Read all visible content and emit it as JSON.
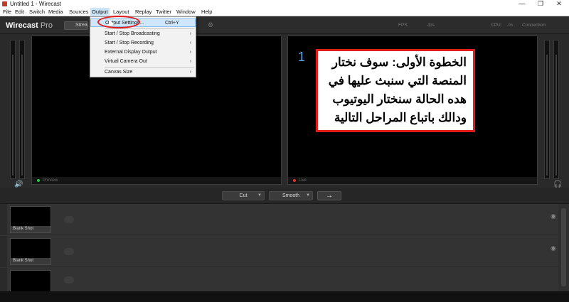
{
  "window": {
    "title": "Untitled 1 - Wirecast",
    "minimize": "—",
    "maximize": "❐",
    "close": "✕"
  },
  "menubar": [
    "File",
    "Edit",
    "Switch",
    "Media",
    "Sources",
    "Output",
    "Layout",
    "Replay",
    "Twitter",
    "Window",
    "Help"
  ],
  "toolbar": {
    "logo": "Wirecast",
    "logo_suffix": "Pro",
    "stream_label": "Stream",
    "fps_label": "FPS:",
    "fps_value": "-fps",
    "cpu_label": "CPU:",
    "cpu_value": "-%",
    "connection_label": "Connection:"
  },
  "output_menu": {
    "items": [
      {
        "label": "Output Settings...",
        "shortcut": "Ctrl+Y",
        "submenu": ""
      },
      {
        "label": "Start / Stop Broadcasting",
        "shortcut": "",
        "submenu": "›"
      },
      {
        "label": "Start / Stop Recording",
        "shortcut": "",
        "submenu": "›"
      },
      {
        "label": "External Display Output",
        "shortcut": "",
        "submenu": "›"
      },
      {
        "label": "Virtual Camera Out",
        "shortcut": "",
        "submenu": "›"
      },
      {
        "label": "Canvas Size",
        "shortcut": "",
        "submenu": "›"
      }
    ]
  },
  "preview": {
    "label": "Preview",
    "dot_color": "#27c93f"
  },
  "live": {
    "label": "Live",
    "dot_color": "#e0322b"
  },
  "annotation": {
    "step": "1",
    "lines": [
      "الخطوة الأولى: سوف نختار",
      "المنصة التي سنبث عليها في",
      "هده الحالة سنختار اليوتيوب",
      "ودالك باتباع المراحل التالية"
    ]
  },
  "transition": {
    "cut_label": "Cut",
    "smooth_label": "Smooth",
    "go_icon": "→"
  },
  "layers": [
    {
      "shot_name": "Blank Shot"
    },
    {
      "shot_name": "Blank Shot"
    },
    {
      "shot_name": ""
    }
  ],
  "colors": {
    "accent_red": "#e21b1b",
    "step_blue": "#5ea6e6",
    "menu_highlight": "#cfe6fb"
  }
}
